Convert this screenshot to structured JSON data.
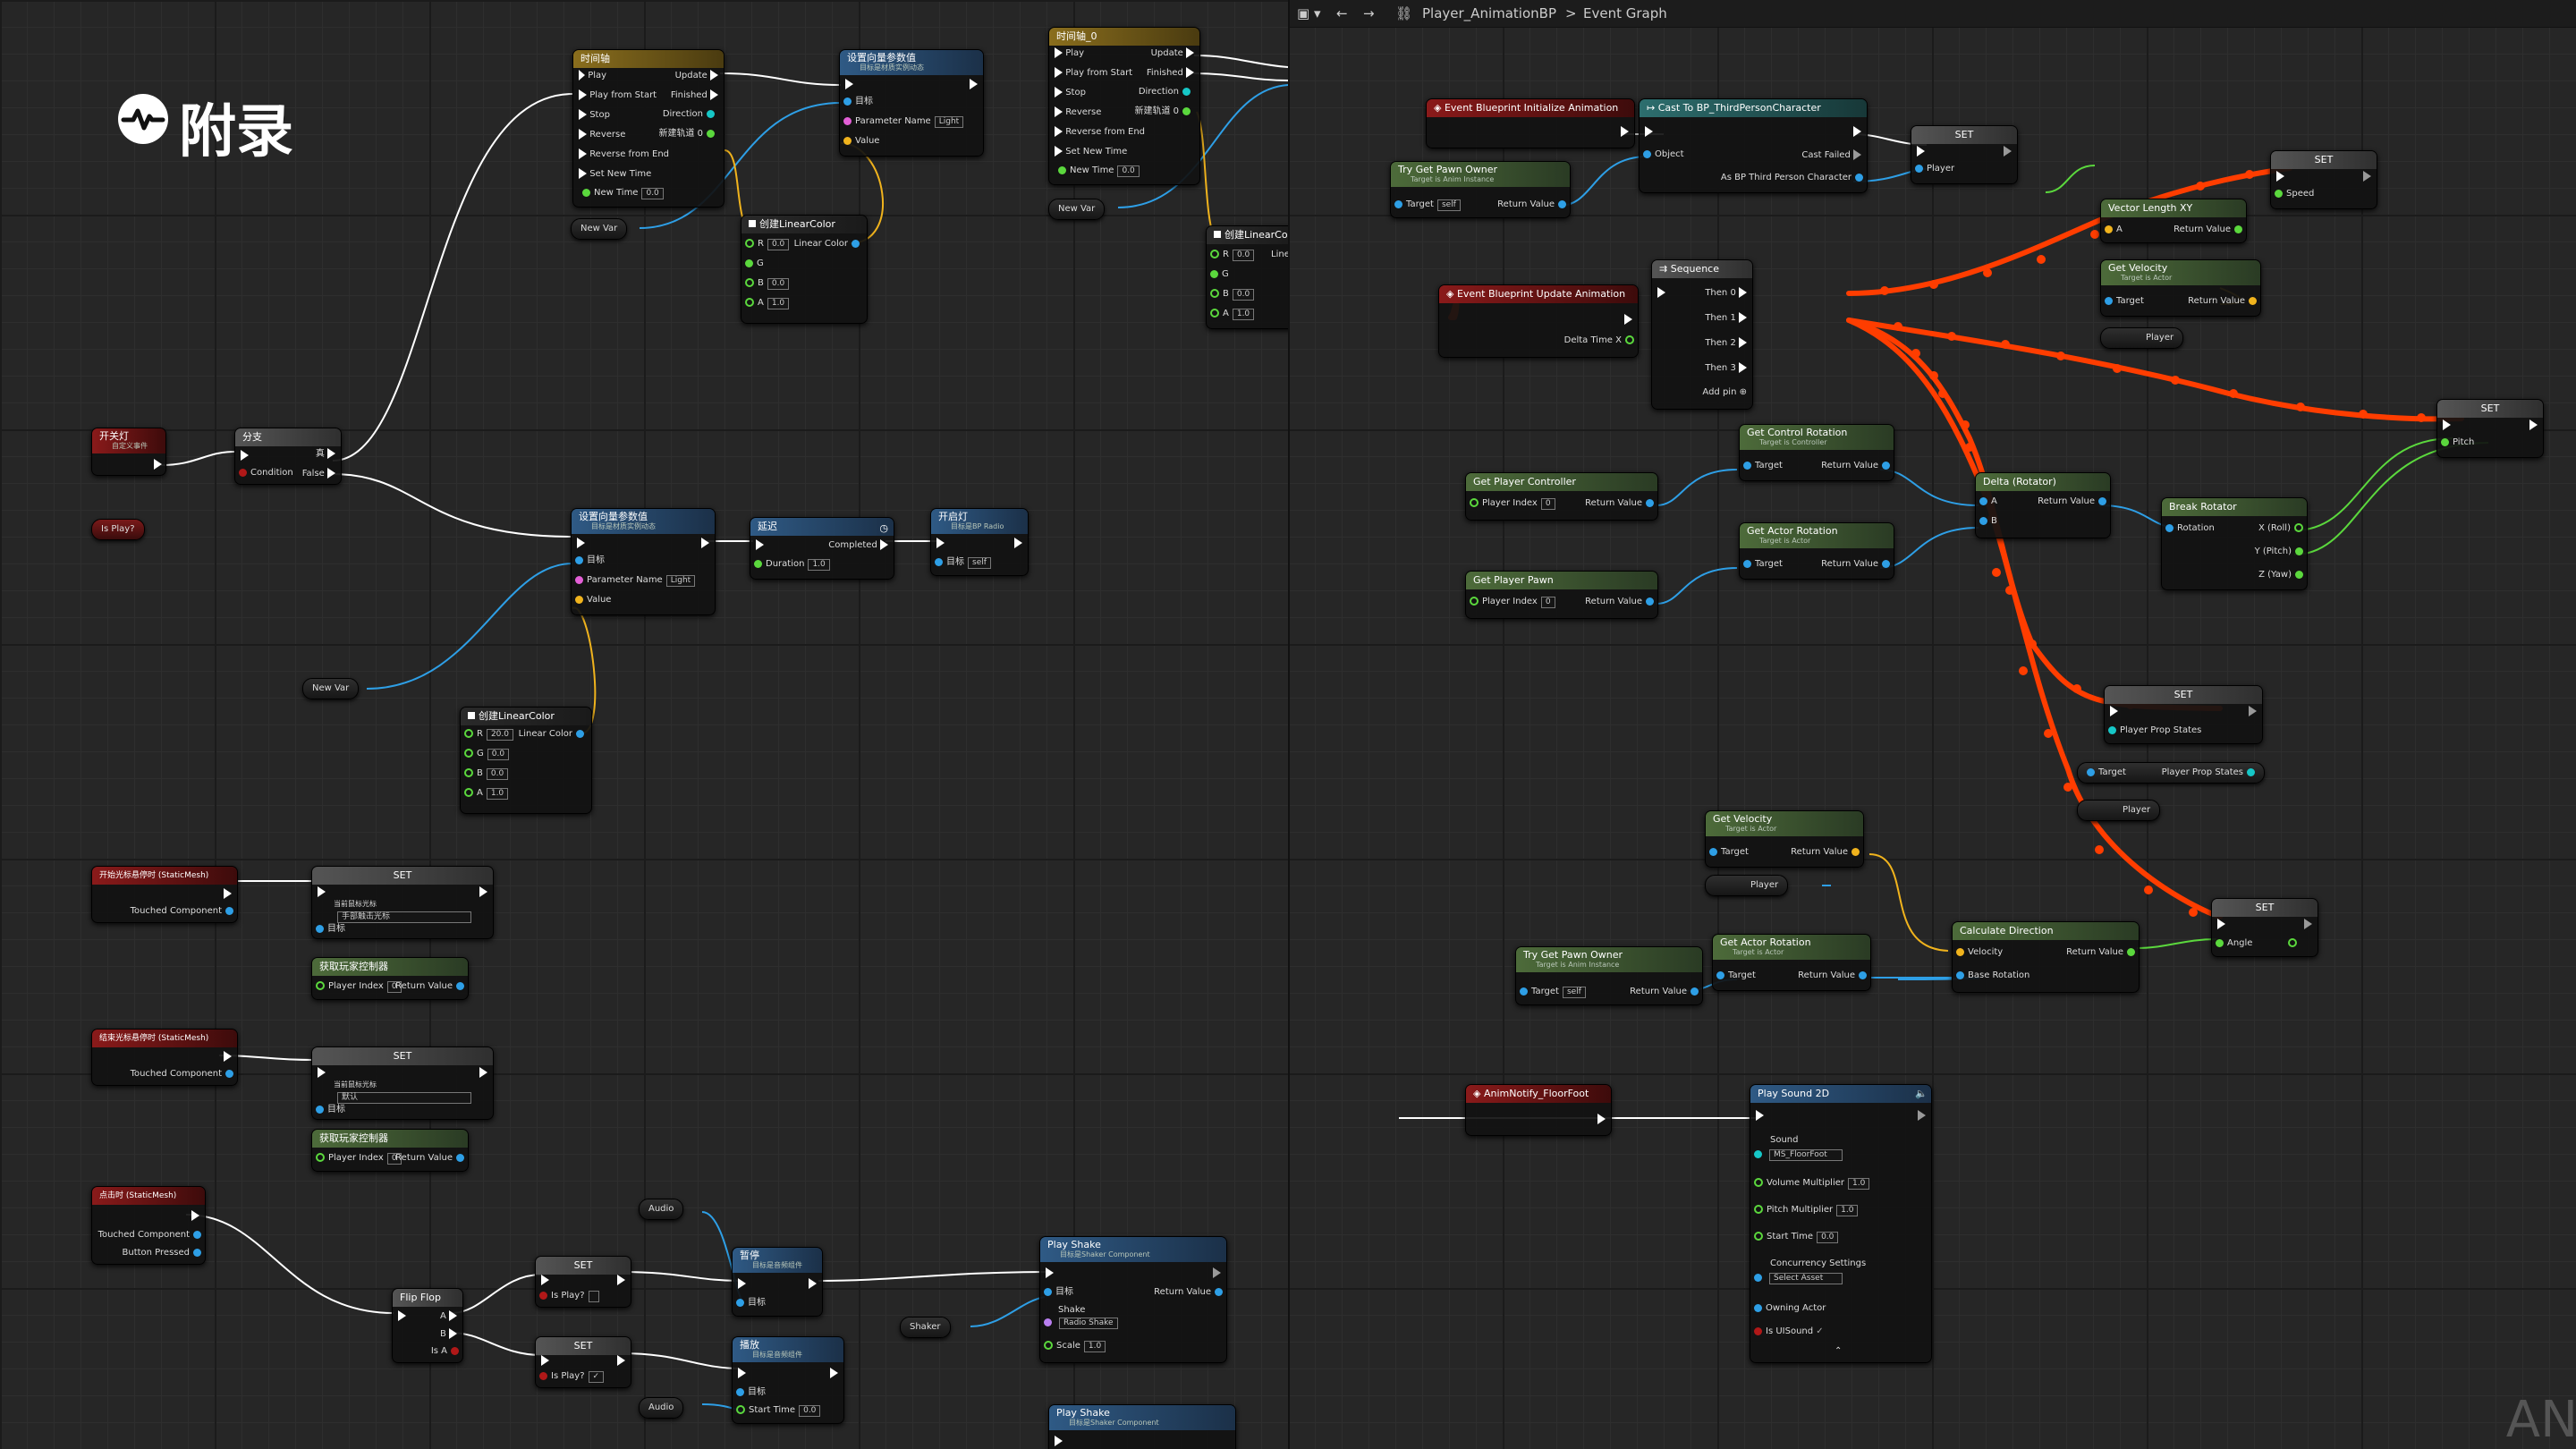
{
  "title": "附录",
  "breadcrumb": {
    "root": "Player_AnimationBP",
    "current": "Event Graph"
  },
  "corner_text": "AN",
  "left": {
    "node_timeline1": {
      "title": "时间轴",
      "pins": [
        "Play",
        "Play from Start",
        "Stop",
        "Reverse",
        "Reverse from End",
        "Set New Time",
        "New Time"
      ],
      "outs": [
        "Update",
        "Finished",
        "Direction",
        "新建轨道 0"
      ],
      "new_time": "0.0"
    },
    "node_setparam1": {
      "title": "设置向量参数值",
      "sub": "目标是材质实例动态",
      "pins": [
        "目标",
        "Parameter Name",
        "Value"
      ],
      "param": "Light"
    },
    "node_timeline2": {
      "title": "时间轴_0",
      "pins": [
        "Play",
        "Play from Start",
        "Stop",
        "Reverse",
        "Reverse from End",
        "Set New Time",
        "New Time"
      ],
      "outs": [
        "Update",
        "Finished",
        "Direction",
        "新建轨道 0"
      ],
      "new_time": "0.0"
    },
    "node_lincolor1": {
      "title": "创建LinearColor",
      "pins": [
        "R",
        "G",
        "B",
        "A"
      ],
      "vals": [
        "0.0",
        "",
        "0.0",
        "1.0"
      ],
      "out": "Linear Color"
    },
    "node_lincolor_edge": {
      "title": "创建LinearColor",
      "pins": [
        "R",
        "G",
        "B",
        "A"
      ],
      "vals": [
        "0.0",
        "",
        "0.0",
        "1.0"
      ],
      "out": "Line"
    },
    "var_newvar1": "New Var",
    "var_newvar2": "New Var",
    "event1": {
      "title": "开关灯",
      "sub": "自定义事件"
    },
    "branch": {
      "title": "分支",
      "in": "Condition",
      "true": "真",
      "false": "False"
    },
    "var_isplay": "Is Play?",
    "node_setparam2": {
      "title": "设置向量参数值",
      "sub": "目标是材质实例动态",
      "pins": [
        "目标",
        "Parameter Name",
        "Value"
      ],
      "param": "Light"
    },
    "node_delay": {
      "title": "延迟",
      "pins": [
        "Duration"
      ],
      "duration": "1.0",
      "out": "Completed"
    },
    "node_audio": {
      "title": "开启灯",
      "sub": "目标是BP Radio",
      "pin": "目标",
      "val": "self"
    },
    "var_newvar3": "New Var",
    "node_lincolor2": {
      "title": "创建LinearColor",
      "pins": [
        "R",
        "G",
        "B",
        "A"
      ],
      "vals": [
        "20.0",
        "0.0",
        "0.0",
        "1.0"
      ],
      "out": "Linear Color"
    },
    "event_hover_on": {
      "title": "开始光标悬停时 (StaticMesh)",
      "out": "Touched Component"
    },
    "set1": {
      "title": "SET",
      "label": "当前鼠标光标",
      "select": "手部触击光标",
      "target": "目标"
    },
    "getpc1": {
      "title": "获取玩家控制器",
      "pin": "Player Index",
      "val": "0",
      "out": "Return Value"
    },
    "event_hover_off": {
      "title": "结束光标悬停时 (StaticMesh)",
      "out": "Touched Component"
    },
    "set2": {
      "title": "SET",
      "label": "当前鼠标光标",
      "select": "默认",
      "target": "目标"
    },
    "getpc2": {
      "title": "获取玩家控制器",
      "pin": "Player Index",
      "val": "0",
      "out": "Return Value"
    },
    "event_click": {
      "title": "点击时 (StaticMesh)",
      "outs": [
        "Touched Component",
        "Button Pressed"
      ]
    },
    "flipflop": {
      "title": "Flip Flop",
      "outs": [
        "A",
        "B",
        "Is A"
      ]
    },
    "set_isplay1": {
      "title": "SET",
      "pin": "Is Play?"
    },
    "set_isplay2": {
      "title": "SET",
      "pin": "Is Play?"
    },
    "var_audio1": "Audio",
    "var_audio2": "Audio",
    "node_pause": {
      "title": "暂停",
      "sub": "目标是音频组件",
      "pin": "目标"
    },
    "node_play": {
      "title": "播放",
      "sub": "目标是音频组件",
      "pins": [
        "目标",
        "Start Time"
      ],
      "val": "0.0"
    },
    "node_playshake1": {
      "title": "Play Shake",
      "sub": "目标是Shaker Component",
      "pins": [
        "目标",
        "Shake",
        "Scale"
      ],
      "shake": "Radio Shake",
      "scale": "1.0",
      "out": "Return Value"
    },
    "var_shaker": "Shaker",
    "node_playshake2": {
      "title": "Play Shake",
      "sub": "目标是Shaker Component"
    }
  },
  "right": {
    "ev_init": {
      "title": "Event Blueprint Initialize Animation"
    },
    "cast": {
      "title": "Cast To BP_ThirdPersonCharacter",
      "in": "Object",
      "outs": [
        "Cast Failed",
        "As BP Third Person Character"
      ]
    },
    "try_owner1": {
      "title": "Try Get Pawn Owner",
      "sub": "Target is Anim Instance",
      "pin": "Target",
      "val": "self",
      "out": "Return Value"
    },
    "set_player": {
      "title": "SET",
      "pin": "Player"
    },
    "ev_update": {
      "title": "Event Blueprint Update Animation",
      "out": "Delta Time X"
    },
    "sequence": {
      "title": "Sequence",
      "outs": [
        "Then 0",
        "Then 1",
        "Then 2",
        "Then 3"
      ],
      "add": "Add pin"
    },
    "set_speed": {
      "title": "SET",
      "pin": "Speed"
    },
    "vlen": {
      "title": "Vector Length XY",
      "in": "A",
      "out": "Return Value"
    },
    "getvel1": {
      "title": "Get Velocity",
      "sub": "Target is Actor",
      "in": "Target",
      "out": "Return Value"
    },
    "var_player1": "Player",
    "get_ctrl_rot": {
      "title": "Get Control Rotation",
      "sub": "Target is Controller",
      "in": "Target",
      "out": "Return Value"
    },
    "get_pc": {
      "title": "Get Player Controller",
      "pin": "Player Index",
      "val": "0",
      "out": "Return Value"
    },
    "delta_rot": {
      "title": "Delta (Rotator)",
      "ins": [
        "A",
        "B"
      ],
      "out": "Return Value"
    },
    "break_rot": {
      "title": "Break Rotator",
      "in": "Rotation",
      "outs": [
        "X (Roll)",
        "Y (Pitch)",
        "Z (Yaw)"
      ]
    },
    "set_pitch": {
      "title": "SET",
      "pin": "Pitch"
    },
    "get_actor_rot1": {
      "title": "Get Actor Rotation",
      "sub": "Target is Actor",
      "in": "Target",
      "out": "Return Value"
    },
    "get_pawn": {
      "title": "Get Player Pawn",
      "pin": "Player Index",
      "val": "0",
      "out": "Return Value"
    },
    "set_props": {
      "title": "SET",
      "pin": "Player Prop States"
    },
    "prop_get": {
      "in": "Target",
      "out": "Player Prop States"
    },
    "var_player2": "Player",
    "getvel2": {
      "title": "Get Velocity",
      "sub": "Target is Actor",
      "in": "Target",
      "out": "Return Value"
    },
    "var_player3": "Player",
    "calc_dir": {
      "title": "Calculate Direction",
      "ins": [
        "Velocity",
        "Base Rotation"
      ],
      "out": "Return Value"
    },
    "set_angle": {
      "title": "SET",
      "pin": "Angle"
    },
    "try_owner2": {
      "title": "Try Get Pawn Owner",
      "sub": "Target is Anim Instance",
      "pin": "Target",
      "val": "self",
      "out": "Return Value"
    },
    "get_actor_rot2": {
      "title": "Get Actor Rotation",
      "sub": "Target is Actor",
      "in": "Target",
      "out": "Return Value"
    },
    "anim_notify": {
      "title": "AnimNotify_FloorFoot"
    },
    "play_sound": {
      "title": "Play Sound 2D",
      "pins": [
        "Sound",
        "Volume Multiplier",
        "Pitch Multiplier",
        "Start Time",
        "Concurrency Settings",
        "Owning Actor",
        "Is UISound"
      ],
      "sound": "MS_FloorFoot",
      "vol": "1.0",
      "pitch": "1.0",
      "start": "0.0",
      "conc": "Select Asset"
    }
  }
}
